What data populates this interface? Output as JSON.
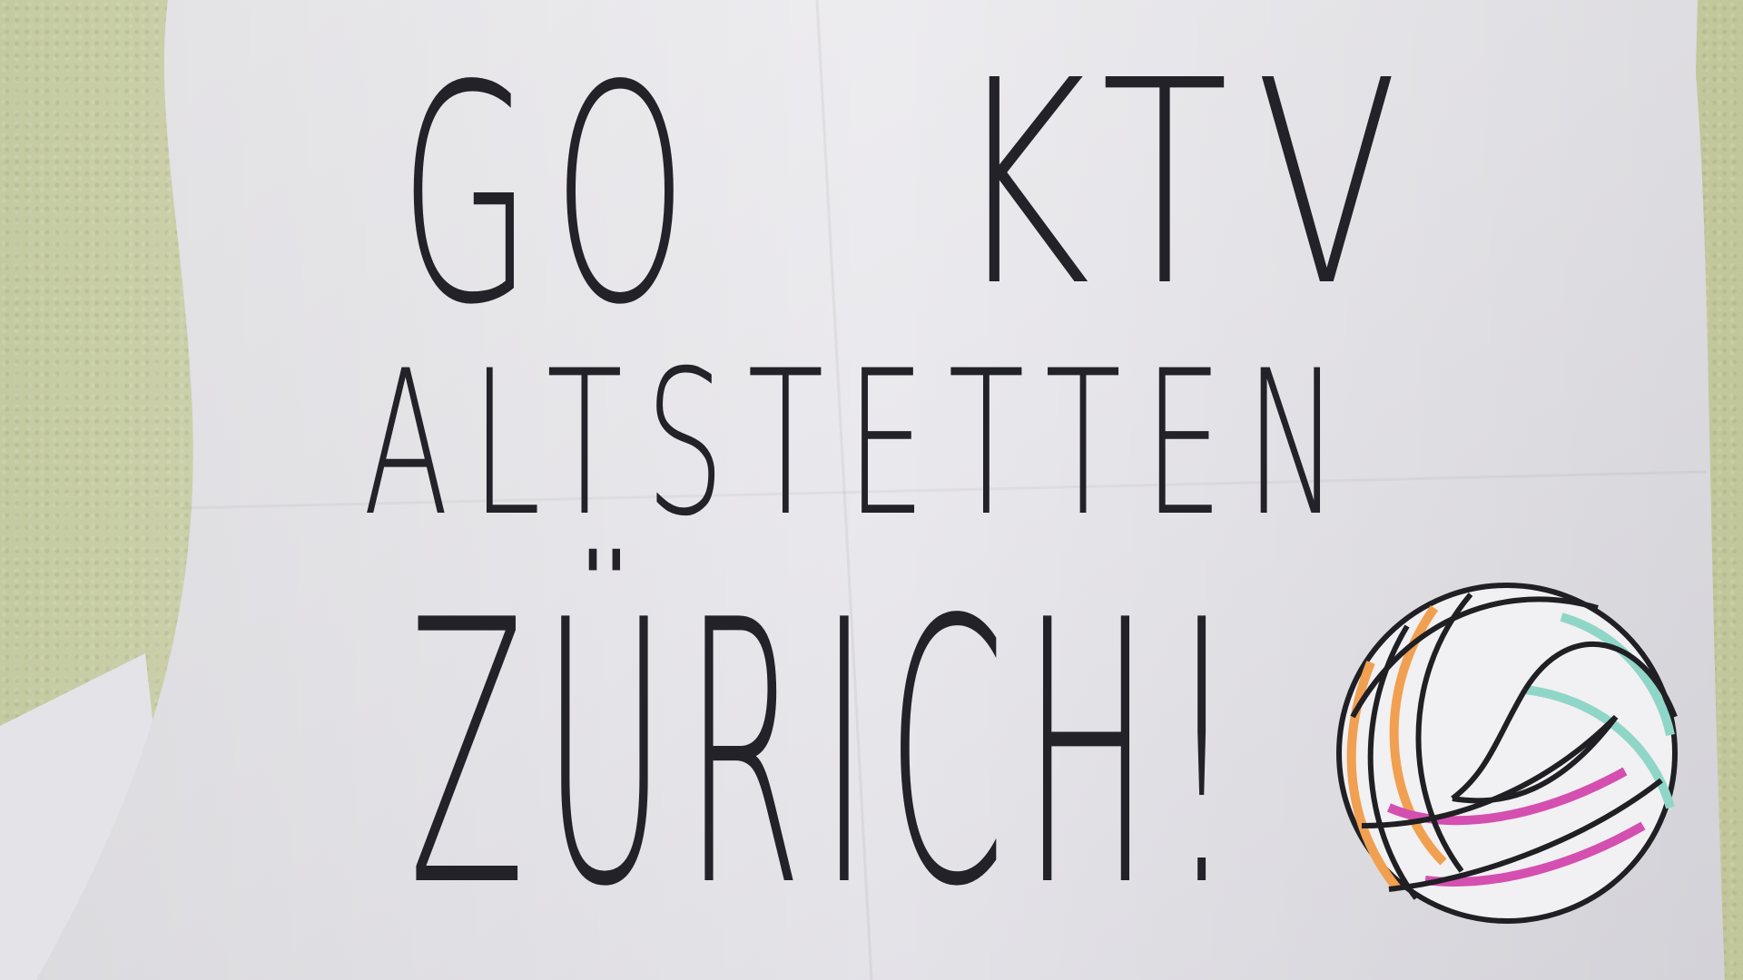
{
  "poster": {
    "line1_left": "GO",
    "line1_right": "KTV",
    "line2": "ALTSTETTEN",
    "line3": "ZÜRICH!"
  },
  "colors": {
    "wall": "#c9cfa8",
    "paper": "#ecebee",
    "ink": "#222228",
    "ball_orange": "#f0a050",
    "ball_teal": "#8fd6c8",
    "ball_magenta": "#d44fb0"
  }
}
